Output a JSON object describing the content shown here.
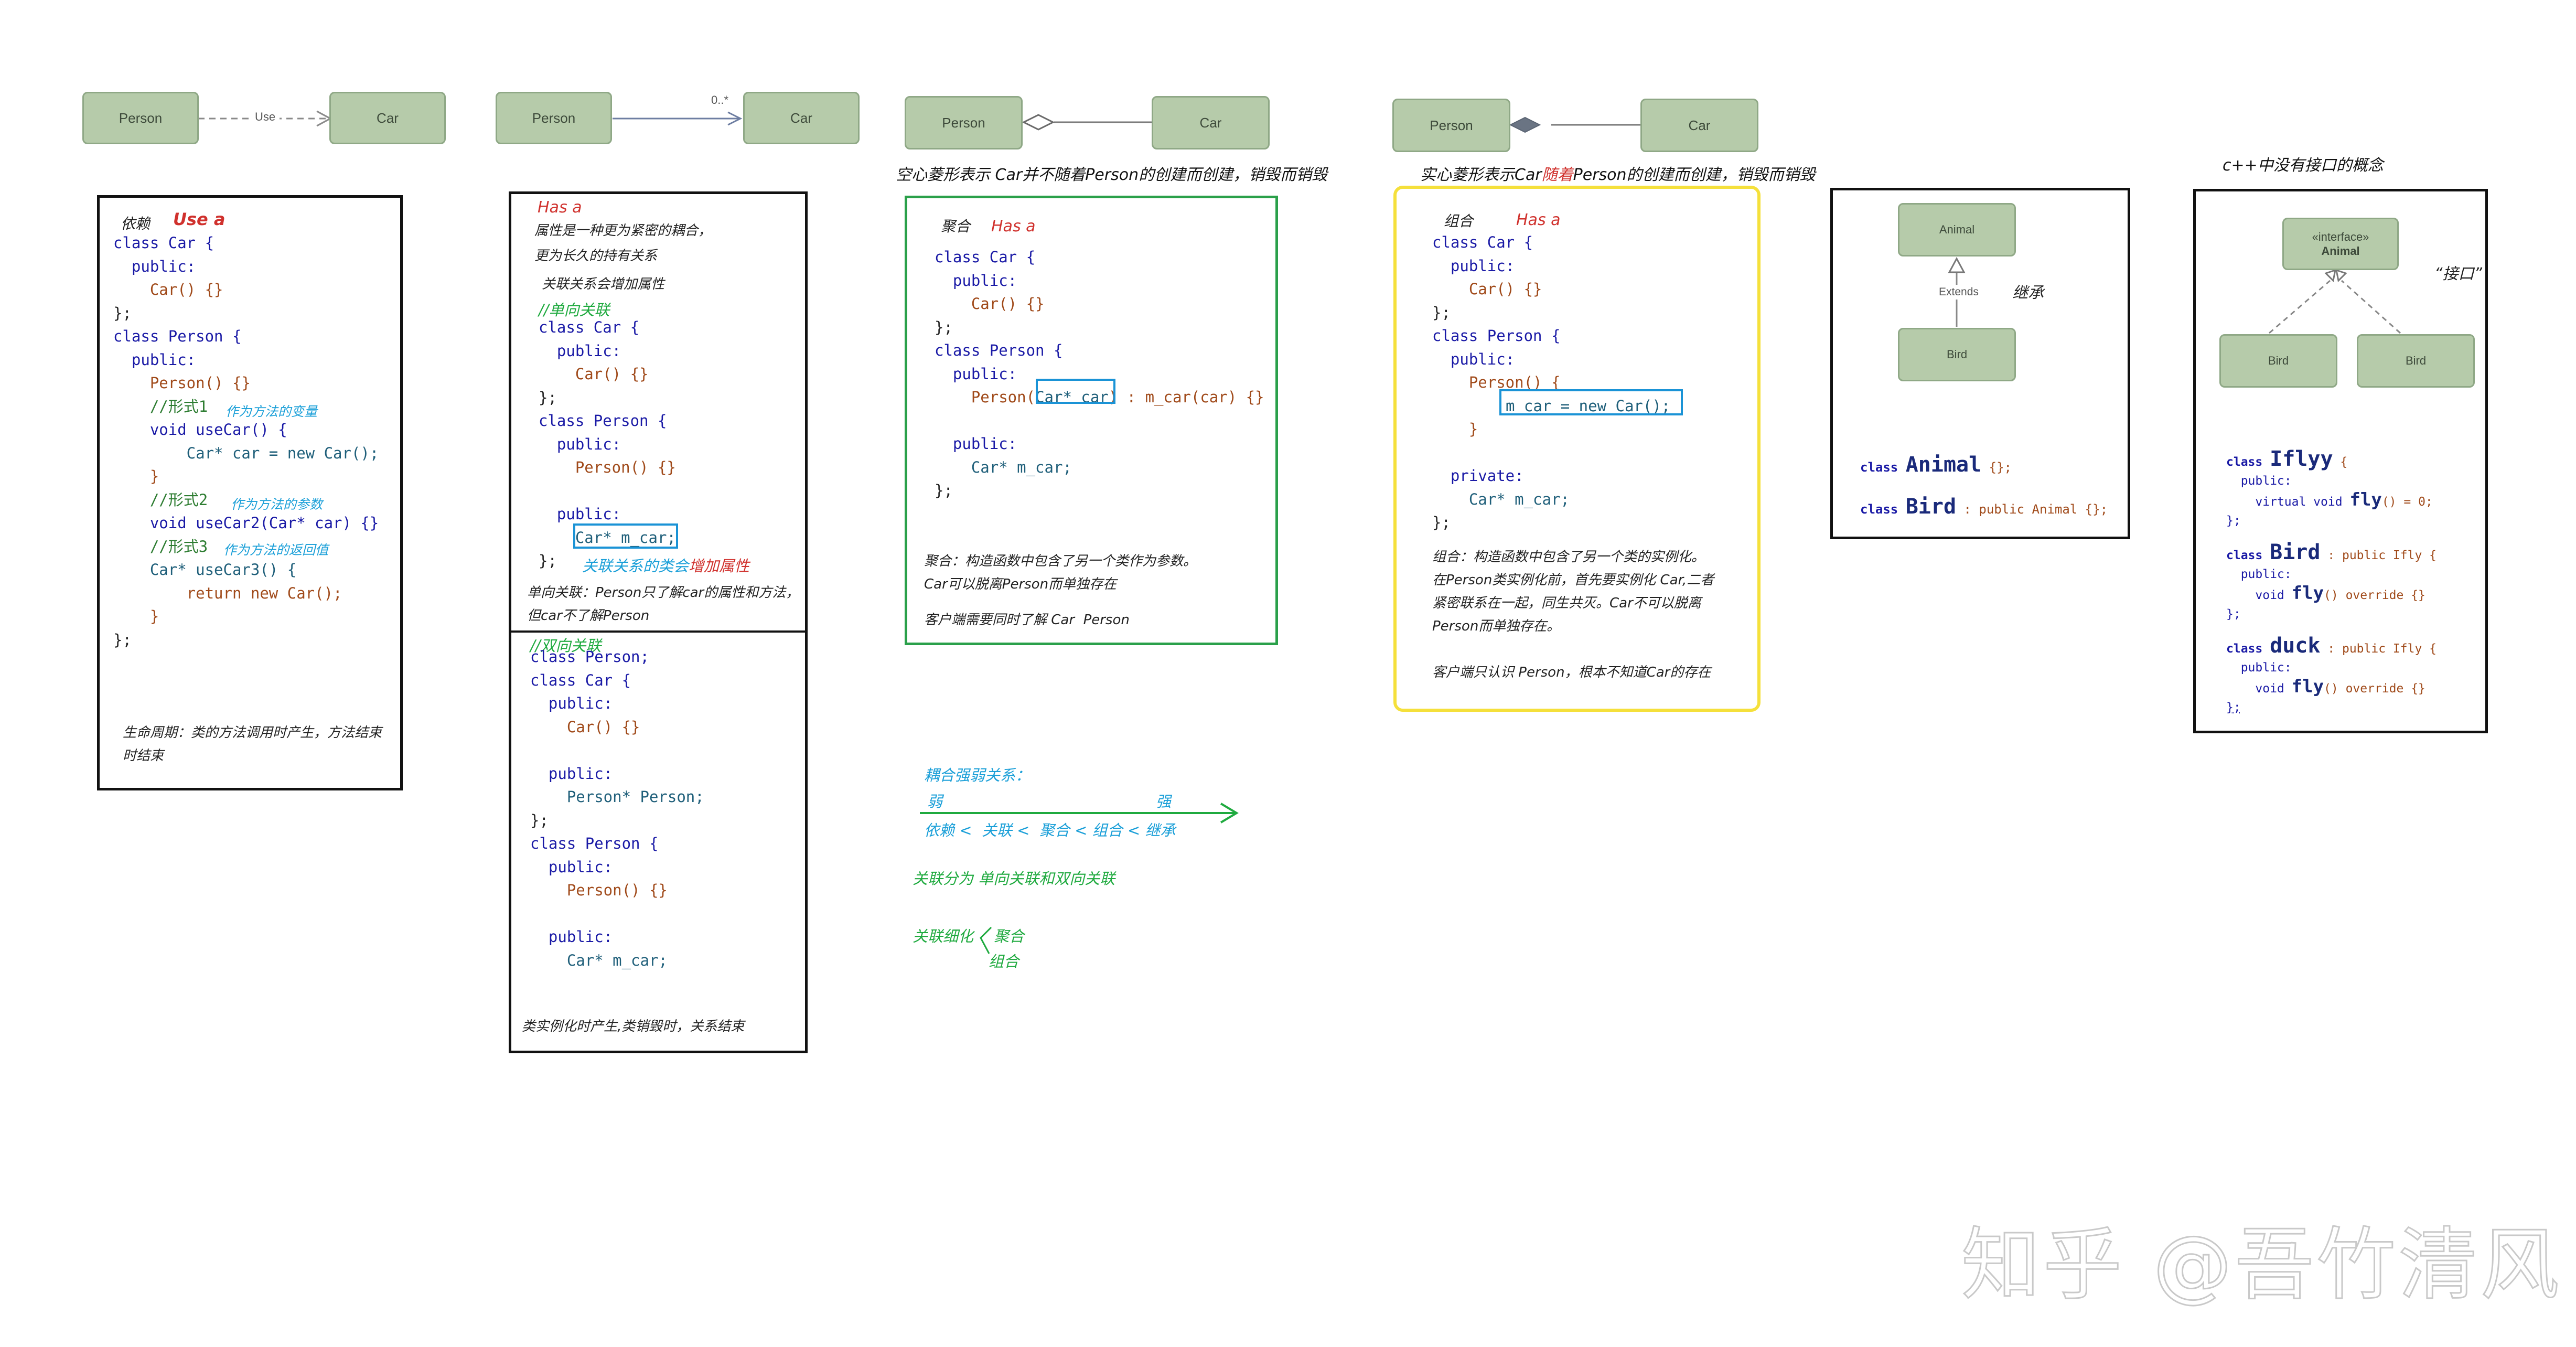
{
  "colors": {
    "uml_fill": "#b6cbaa",
    "uml_border": "#8fa886",
    "accent_red": "#d0312d",
    "accent_blue": "#1a9fd8",
    "accent_green": "#1faa3f",
    "aggregation_border": "#2aa04a",
    "composition_border": "#f5e03b"
  },
  "d1": {
    "person": "Person",
    "car": "Car",
    "use": "Use"
  },
  "d2": {
    "person": "Person",
    "car": "Car",
    "mult": "0..*"
  },
  "d3": {
    "person": "Person",
    "car": "Car",
    "caption": "空心菱形表示 Car并不随着Person的创建而创建，销毁而销毁"
  },
  "d4": {
    "person": "Person",
    "car": "Car",
    "caption_a": "实心菱形表示Car",
    "caption_b": "随着",
    "caption_c": "Person的创建而创建，销毁而销毁"
  },
  "p1": {
    "title": "依赖",
    "tag": "Use a",
    "l1": "class Car {",
    "l2": "  public:",
    "l3": "    Car() {}",
    "l4": "};",
    "l5": "class Person {",
    "l6": "  public:",
    "l7": "    Person() {}",
    "l8": "    //形式1",
    "a8": "作为方法的变量",
    "l9": "    void useCar() {",
    "l10": "        Car* car = new Car();",
    "l11": "    }",
    "l12": "    //形式2",
    "a12": "作为方法的参数",
    "l13": "    void useCar2(Car* car) {}",
    "l14": "    //形式3",
    "a14": "作为方法的返回值",
    "l15": "    Car* useCar3() {",
    "l16": "        return new Car();",
    "l17": "    }",
    "l18": "};",
    "foot1": "生命周期：类的方法调用时产生，方法结束",
    "foot2": "时结束"
  },
  "p2": {
    "tag": "Has a",
    "n1": "属性是一种更为紧密的耦合，",
    "n2": "更为长久的持有关系",
    "n3": "关联关系会增加属性",
    "c1": "//单向关联",
    "l1": "class Car {",
    "l2": "  public:",
    "l3": "    Car() {}",
    "l4": "};",
    "l5": "class Person {",
    "l6": "  public:",
    "l7": "    Person() {}",
    "l8": "",
    "l9": "  public:",
    "l10": "    Car* m_car;",
    "l11": "};",
    "a11a": "关联关系的类会",
    "a11b": "增加属性",
    "f1": "单向关联：Person只了解car的属性和方法，",
    "f2": "但car不了解Person"
  },
  "p3": {
    "c1": "//双向关联",
    "l1": "class Person;",
    "l2": "class Car {",
    "l3": "  public:",
    "l4": "    Car() {}",
    "l5": "",
    "l6": "  public:",
    "l7": "    Person* Person;",
    "l8": "};",
    "l9": "class Person {",
    "l10": "  public:",
    "l11": "    Person() {}",
    "l12": "",
    "l13": "  public:",
    "l14": "    Car* m_car;",
    "foot": "类实例化时产生,类销毁时，关系结束"
  },
  "p4": {
    "title": "聚合",
    "tag": "Has a",
    "l1": "class Car {",
    "l2": "  public:",
    "l3": "    Car() {}",
    "l4": "};",
    "l5": "class Person {",
    "l6": "  public:",
    "l7a": "    Person(",
    "l7b": "Car* car",
    "l7c": ") : m_car(car) {}",
    "l8": "",
    "l9": "  public:",
    "l10": "    Car* m_car;",
    "l11": "};",
    "f1": "聚合：构造函数中包含了另一个类作为参数。",
    "f2": "Car可以脱离Person而单独存在",
    "f3": "客户端需要同时了解 Car  Person"
  },
  "p5": {
    "title": "组合",
    "tag": "Has a",
    "l1": "class Car {",
    "l2": "  public:",
    "l3": "    Car() {}",
    "l4": "};",
    "l5": "class Person {",
    "l6": "  public:",
    "l7": "    Person() {",
    "l8": "m_car = new Car();",
    "l9": "    }",
    "l10": "",
    "l11": "  private:",
    "l12": "    Car* m_car;",
    "l13": "};",
    "f1": "组合：构造函数中包含了另一个类的实例化。",
    "f2": "在Person类实例化前，首先要实例化 Car,二者",
    "f3": "紧密联系在一起，同生共灭。Car不可以脱离",
    "f4": "Person而单独存在。",
    "f5": "客户端只认识 Person，根本不知道Car的存在"
  },
  "p6": {
    "animal": "Animal",
    "bird": "Bird",
    "extends": "Extends",
    "label": "继承",
    "code1_kw": "class",
    "code1_name": "Animal",
    "code1_rest": " {};",
    "code2_kw": "class",
    "code2_name": "Bird",
    "code2_rest": " : public Animal {};"
  },
  "p7": {
    "caption": "c++中没有接口的概念",
    "stereo": "«interface»",
    "iname": "Animal",
    "bird1": "Bird",
    "bird2": "Bird",
    "quote": "“接口”",
    "a1": "class",
    "a2": "Iflyy",
    "a3": " {",
    "a4": "  public:",
    "a5": "    virtual void ",
    "a6": "fly",
    "a7": "() = 0;",
    "a8": "};",
    "b1": "class",
    "b2": "Bird",
    "b3": " : public Ifly {",
    "b4": "  public:",
    "b5": "    void ",
    "b6": "fly",
    "b7": "() override {}",
    "b8": "};",
    "c1": "class",
    "c2": "duck",
    "c3": " : public Ifly {",
    "c4": "  public:",
    "c5": "    void ",
    "c6": "fly",
    "c7": "() override {}",
    "c8": "};"
  },
  "summary": {
    "title": "耦合强弱关系：",
    "weak": "弱",
    "strong": "强",
    "order": "依赖 <  关联 <  聚合 < 组合 < 继承",
    "split": "关联分为 单向关联和双向关联",
    "refine": "关联细化",
    "agg": "聚合",
    "comp": "组合"
  },
  "watermark": "知乎 @吾竹清风"
}
